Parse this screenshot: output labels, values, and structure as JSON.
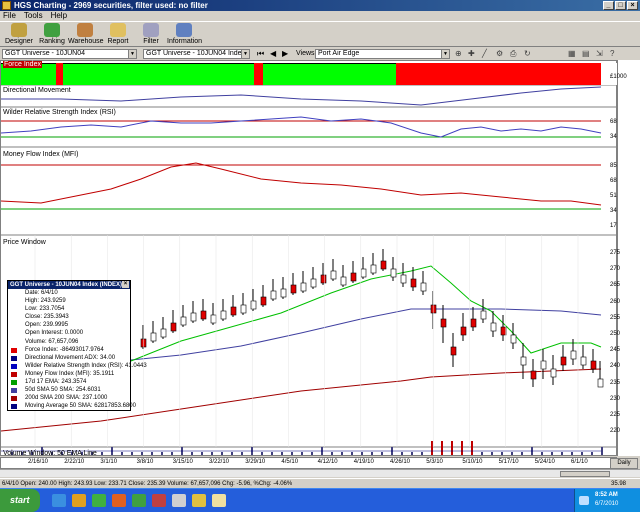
{
  "window": {
    "title": "HGS Charting - 2969 securities, filter used: no filter"
  },
  "menu": [
    "File",
    "Tools",
    "Help"
  ],
  "toolbar": {
    "buttons": [
      {
        "label": "Designer",
        "icon": "designer-icon",
        "color": "#c0a040"
      },
      {
        "label": "Ranking",
        "icon": "ranking-icon",
        "color": "#40a040"
      },
      {
        "label": "Warehouse",
        "icon": "warehouse-icon",
        "color": "#c08040"
      },
      {
        "label": "Report",
        "icon": "report-icon",
        "color": "#e0c060"
      },
      {
        "label": "Filter",
        "icon": "filter-icon",
        "color": "#a0a0c0"
      },
      {
        "label": "Information",
        "icon": "information-icon",
        "color": "#6080c0"
      }
    ]
  },
  "selectors": {
    "universe": "GGT Universe - 10JUN04",
    "security": "GGT Universe - 10JUN04 Index",
    "views_label": "Views:",
    "view": "Port Air Edge"
  },
  "panels": {
    "force_index": {
      "label": "Force Index",
      "value": "£1000"
    },
    "directional_movement": {
      "label": "Directional Movement"
    },
    "rsi": {
      "label": "Wilder Relative Strength Index (RSI)",
      "ticks": [
        "68",
        "34"
      ]
    },
    "mfi": {
      "label": "Money Flow Index (MFI)",
      "ticks": [
        "85",
        "68",
        "51",
        "34",
        "17"
      ]
    },
    "price": {
      "label": "Price Window",
      "ticks": [
        "275",
        "270",
        "265",
        "260",
        "255",
        "250",
        "245",
        "240",
        "235",
        "230",
        "225",
        "220"
      ]
    },
    "volume": {
      "label": "Volume Window: 50 EMA Line"
    }
  },
  "x_axis": {
    "dates": [
      "2/16/10",
      "2/22/10",
      "3/1/10",
      "3/8/10",
      "3/15/10",
      "3/22/10",
      "3/29/10",
      "4/5/10",
      "4/12/10",
      "4/19/10",
      "4/26/10",
      "5/3/10",
      "5/10/10",
      "5/17/10",
      "5/24/10",
      "6/1/10"
    ]
  },
  "legend": {
    "title": "GGT Universe - 10JUN04 Index (INDEX)",
    "rows": [
      {
        "text": "Date: 6/4/10",
        "color": ""
      },
      {
        "text": "High: 243.9259",
        "color": ""
      },
      {
        "text": "Low: 233.7054",
        "color": ""
      },
      {
        "text": "Close: 235.3943",
        "color": ""
      },
      {
        "text": "Open: 239.9995",
        "color": ""
      },
      {
        "text": "Open Interest: 0.0000",
        "color": ""
      },
      {
        "text": "Volume: 67,657,096",
        "color": ""
      },
      {
        "text": "Force Index: -86493017.9764",
        "color": "#e00000"
      },
      {
        "text": "Directional Movement ADX: 34.00",
        "color": "#000080"
      },
      {
        "text": "Wilder Relative Strength Index (RSI): 41.0443",
        "color": "#0000c0"
      },
      {
        "text": "Money Flow Index (MFI): 35.1911",
        "color": "#c00000"
      },
      {
        "text": "17d 17 EMA: 243.3574",
        "color": "#00a000"
      },
      {
        "text": "50d SMA 50 SMA: 254.6031",
        "color": "#4040a0"
      },
      {
        "text": "200d SMA 200 SMA: 237.1000",
        "color": "#a00000"
      },
      {
        "text": "Moving Average 50 SMA: 62817853.6800",
        "color": "#000080"
      }
    ]
  },
  "daily_button": "Daily",
  "status": {
    "left": "6/4/10 Open: 240.00 High: 243.93 Low: 233.71 Close: 235.39 Volume: 67,657,096 Chg: -5.96, %Chg: -4.06%",
    "right": "35.98"
  },
  "taskbar": {
    "start": "start",
    "time": "8:52 AM",
    "date": "6/7/2010"
  },
  "colors": {
    "up": "#00ff00",
    "down": "#ff0000",
    "green_line": "#00c000",
    "blue_line": "#4040a0",
    "red_line": "#a00000",
    "candle_up": "#ffffff",
    "candle_down": "#e00000"
  }
}
